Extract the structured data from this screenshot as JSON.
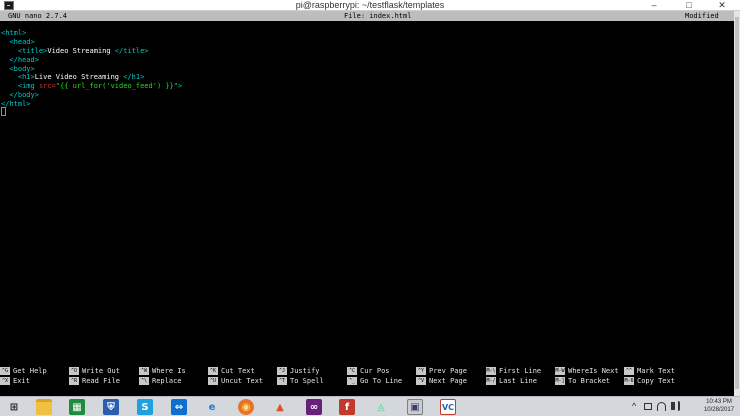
{
  "window": {
    "title": "pi@raspberrypi: ~/testflask/templates",
    "minimize_glyph": "–",
    "maximize_glyph": "□",
    "close_glyph": "✕"
  },
  "nano_header": {
    "version": "GNU nano 2.7.4",
    "file": "File: index.html",
    "status": "Modified"
  },
  "editor": {
    "lines": [
      [
        {
          "t": "<html>",
          "c": "tag"
        }
      ],
      [
        {
          "t": "  <head>",
          "c": "tag"
        }
      ],
      [
        {
          "t": "    <title>",
          "c": "tag"
        },
        {
          "t": "Video Streaming ",
          "c": "white"
        },
        {
          "t": "</title>",
          "c": "tag"
        }
      ],
      [
        {
          "t": "  </head>",
          "c": "tag"
        }
      ],
      [
        {
          "t": "  <body>",
          "c": "tag"
        }
      ],
      [
        {
          "t": "    <h1>",
          "c": "tag"
        },
        {
          "t": "Live Video Streaming ",
          "c": "white"
        },
        {
          "t": "</h1>",
          "c": "tag"
        }
      ],
      [
        {
          "t": "    <img ",
          "c": "tag"
        },
        {
          "t": "src=",
          "c": "red"
        },
        {
          "t": "\"{{ url_for('video_feed') }}\"",
          "c": "green"
        },
        {
          "t": ">",
          "c": "tag"
        }
      ],
      [
        {
          "t": "  </body>",
          "c": "tag"
        }
      ],
      [
        {
          "t": "</html>",
          "c": "tag"
        }
      ]
    ]
  },
  "shortcuts": {
    "row1": [
      {
        "key": "^G",
        "label": "Get Help"
      },
      {
        "key": "^O",
        "label": "Write Out"
      },
      {
        "key": "^W",
        "label": "Where Is"
      },
      {
        "key": "^K",
        "label": "Cut Text"
      },
      {
        "key": "^J",
        "label": "Justify"
      },
      {
        "key": "^C",
        "label": "Cur Pos"
      },
      {
        "key": "^Y",
        "label": "Prev Page"
      },
      {
        "key": "M-\\",
        "label": "First Line"
      },
      {
        "key": "M-W",
        "label": "WhereIs Next"
      },
      {
        "key": "^^",
        "label": "Mark Text"
      }
    ],
    "row2": [
      {
        "key": "^X",
        "label": "Exit"
      },
      {
        "key": "^R",
        "label": "Read File"
      },
      {
        "key": "^\\",
        "label": "Replace"
      },
      {
        "key": "^U",
        "label": "Uncut Text"
      },
      {
        "key": "^T",
        "label": "To Spell"
      },
      {
        "key": "^_",
        "label": "Go To Line"
      },
      {
        "key": "^V",
        "label": "Next Page"
      },
      {
        "key": "M-/",
        "label": "Last Line"
      },
      {
        "key": "M-]",
        "label": "To Bracket"
      },
      {
        "key": "M-6",
        "label": "Copy Text"
      }
    ]
  },
  "taskbar": {
    "icons": [
      {
        "name": "start-windows-icon",
        "glyph": "⊞",
        "bg": "transparent",
        "fg": "#1a1a1a"
      },
      {
        "name": "file-explorer-icon",
        "glyph": "",
        "bg": "#f0c040",
        "fg": "#ffffff"
      },
      {
        "name": "store-icon",
        "glyph": "▦",
        "bg": "#1e8c3c",
        "fg": "#ffffff"
      },
      {
        "name": "security-shield-icon",
        "glyph": "⛨",
        "bg": "#2a5db0",
        "fg": "#ffffff"
      },
      {
        "name": "skype-icon",
        "glyph": "S",
        "bg": "#1fa0e0",
        "fg": "#ffffff"
      },
      {
        "name": "teamviewer-icon",
        "glyph": "⇔",
        "bg": "#0e6fd0",
        "fg": "#ffffff"
      },
      {
        "name": "internet-explorer-icon",
        "glyph": "e",
        "bg": "transparent",
        "fg": "#1f7ad6"
      },
      {
        "name": "firefox-icon",
        "glyph": "◉",
        "bg": "#e8732a",
        "fg": "#ffdf70"
      },
      {
        "name": "matlab-icon",
        "glyph": "▲",
        "bg": "transparent",
        "fg": "#d9541e"
      },
      {
        "name": "visual-studio-icon",
        "glyph": "∞",
        "bg": "#68217a",
        "fg": "#ffffff"
      },
      {
        "name": "filezilla-icon",
        "glyph": "f",
        "bg": "#c0392b",
        "fg": "#ffffff"
      },
      {
        "name": "android-studio-icon",
        "glyph": "◬",
        "bg": "transparent",
        "fg": "#3ddc84"
      },
      {
        "name": "putty-icon",
        "glyph": "▣",
        "bg": "#c9ccd1",
        "fg": "#3a3a6a"
      },
      {
        "name": "vnc-viewer-icon",
        "glyph": "VC",
        "bg": "#ffffff",
        "fg": "#1f63b5"
      }
    ],
    "tray": {
      "chevron": "^",
      "time": "10:43 PM",
      "date": "10/28/2017"
    }
  },
  "colors": {
    "tag": "#00c8c8",
    "string": "#22dd22",
    "attribute": "#d23232",
    "text": "#ffffff",
    "header_bg": "#bdbdbd"
  }
}
